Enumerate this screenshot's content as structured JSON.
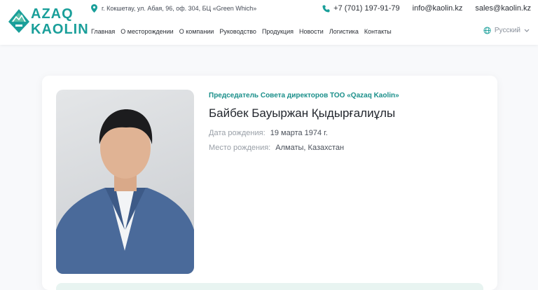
{
  "brand": {
    "line1": "AZAQ",
    "line2": "KAOLIN",
    "accent": "#1a9f9a"
  },
  "header": {
    "address": "г. Кокшетау, ул. Абая, 96, оф. 304, БЦ «Green Which»",
    "phone": "+7 (701) 197-91-79",
    "email_info": "info@kaolin.kz",
    "email_sales": "sales@kaolin.kz",
    "language": "Русский"
  },
  "nav": [
    "Главная",
    "О месторождении",
    "О компании",
    "Руководство",
    "Продукция",
    "Новости",
    "Логистика",
    "Контакты"
  ],
  "person": {
    "role": "Председатель Совета директоров ТОО «Qazaq Kaolin»",
    "name": "Байбек Бауыржан Қыдырғалиұлы",
    "birth_date_label": "Дата рождения:",
    "birth_date": "19 марта 1974 г.",
    "birth_place_label": "Место рождения:",
    "birth_place": "Алматы, Казахстан"
  }
}
